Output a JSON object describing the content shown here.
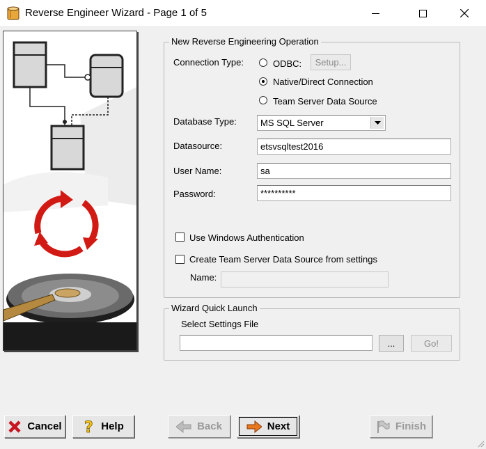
{
  "window": {
    "title": "Reverse Engineer Wizard - Page 1 of 5",
    "controls": [
      "minimize-icon",
      "maximize-icon",
      "close-icon"
    ]
  },
  "new_operation": {
    "legend": "New Reverse Engineering Operation",
    "connection_type_label": "Connection Type:",
    "odbc_label": "ODBC:",
    "setup_button": "Setup...",
    "native_label": "Native/Direct Connection",
    "team_server_label": "Team Server Data Source",
    "selected_connection": "Native/Direct Connection",
    "database_type_label": "Database Type:",
    "database_type_value": "MS SQL Server",
    "datasource_label": "Datasource:",
    "datasource_value": "etsvsqltest2016",
    "username_label": "User Name:",
    "username_value": "sa",
    "password_label": "Password:",
    "password_value": "**********",
    "windows_auth_label": "Use Windows Authentication",
    "create_ts_label": "Create Team Server Data Source from settings",
    "name_label": "Name:",
    "name_value": ""
  },
  "quick_launch": {
    "legend": "Wizard Quick Launch",
    "settings_label": "Select Settings File",
    "settings_value": "",
    "browse_button": "...",
    "go_button": "Go!"
  },
  "buttons": {
    "cancel": "Cancel",
    "help": "Help",
    "back": "Back",
    "next": "Next",
    "finish": "Finish"
  },
  "icons": [
    "app-database-icon",
    "cancel-x-icon",
    "help-question-icon",
    "back-arrow-icon",
    "next-arrow-icon",
    "finish-flag-icon"
  ],
  "colors": {
    "accent_red": "#e0281e",
    "next_arrow_orange": "#e8781e",
    "background": "#f0f0f0"
  }
}
